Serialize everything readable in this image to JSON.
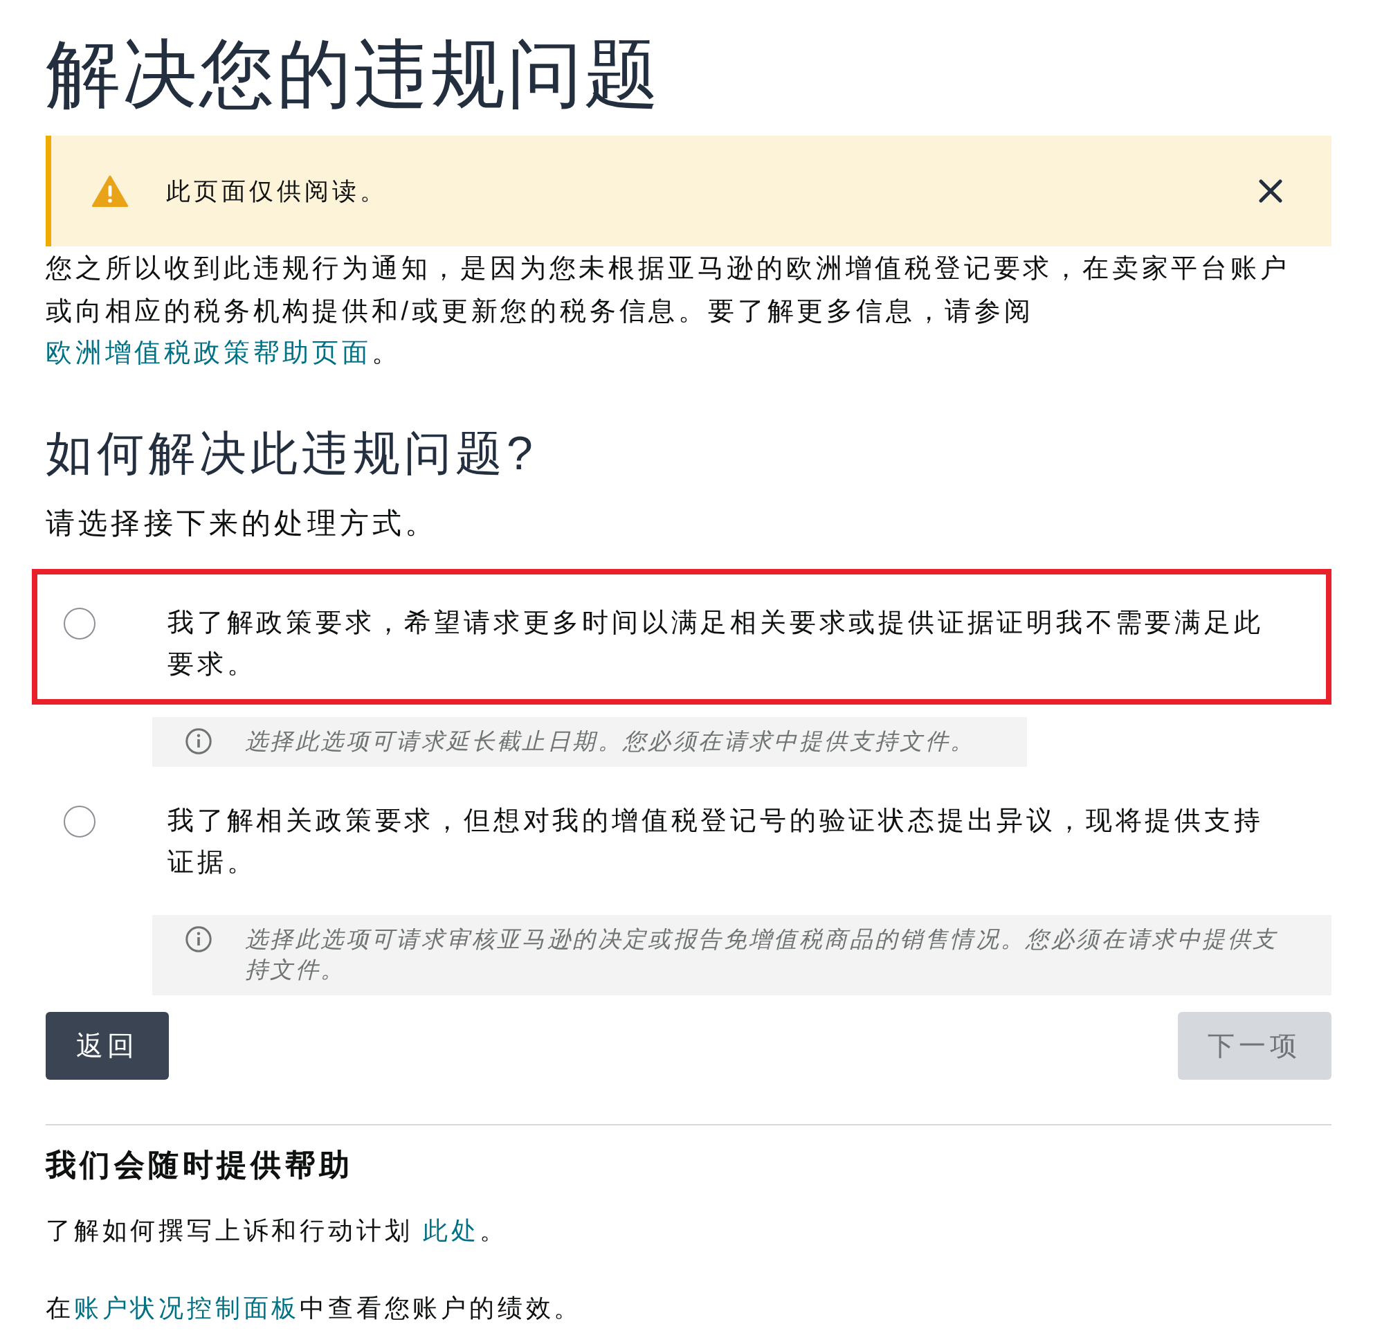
{
  "page": {
    "title": "解决您的违规问题"
  },
  "alert": {
    "kind": "warning",
    "text": "此页面仅供阅读。"
  },
  "intro": {
    "segments": [
      {
        "kind": "text",
        "text": "您之所以收到此违规行为通知，是因为您未根据亚马逊的欧洲增值税登记要求，在卖家平台账户或向相应的税务机构提供和/或更新您的税务信息。要了解更多信息，请参阅"
      },
      {
        "kind": "link",
        "text": "欧洲增值税政策帮助页面"
      },
      {
        "kind": "text",
        "text": "。"
      }
    ]
  },
  "resolution": {
    "heading": "如何解决此违规问题?",
    "prompt": "请选择接下来的处理方式。",
    "options": [
      {
        "label": "我了解政策要求，希望请求更多时间以满足相关要求或提供证据证明我不需要满足此要求。",
        "selected": false,
        "highlighted": true,
        "hint": "选择此选项可请求延长截止日期。您必须在请求中提供支持文件。"
      },
      {
        "label": "我了解相关政策要求，但想对我的增值税登记号的验证状态提出异议，现将提供支持证据。",
        "selected": false,
        "highlighted": false,
        "hint": "选择此选项可请求审核亚马逊的决定或报告免增值税商品的销售情况。您必须在请求中提供支持文件。"
      }
    ]
  },
  "buttons": [
    {
      "kind": "back",
      "label": "返回",
      "disabled": false
    },
    {
      "kind": "next",
      "label": "下一项",
      "disabled": true
    }
  ],
  "help": {
    "heading": "我们会随时提供帮助",
    "lines": [
      {
        "segments": [
          {
            "kind": "text",
            "text": "了解如何撰写上诉和行动计划 "
          },
          {
            "kind": "link",
            "text": "此处"
          },
          {
            "kind": "text",
            "text": "。"
          }
        ]
      },
      {
        "segments": [
          {
            "kind": "text",
            "text": "在"
          },
          {
            "kind": "link",
            "text": "账户状况控制面板"
          },
          {
            "kind": "text",
            "text": "中查看您账户的绩效。"
          }
        ]
      }
    ]
  }
}
